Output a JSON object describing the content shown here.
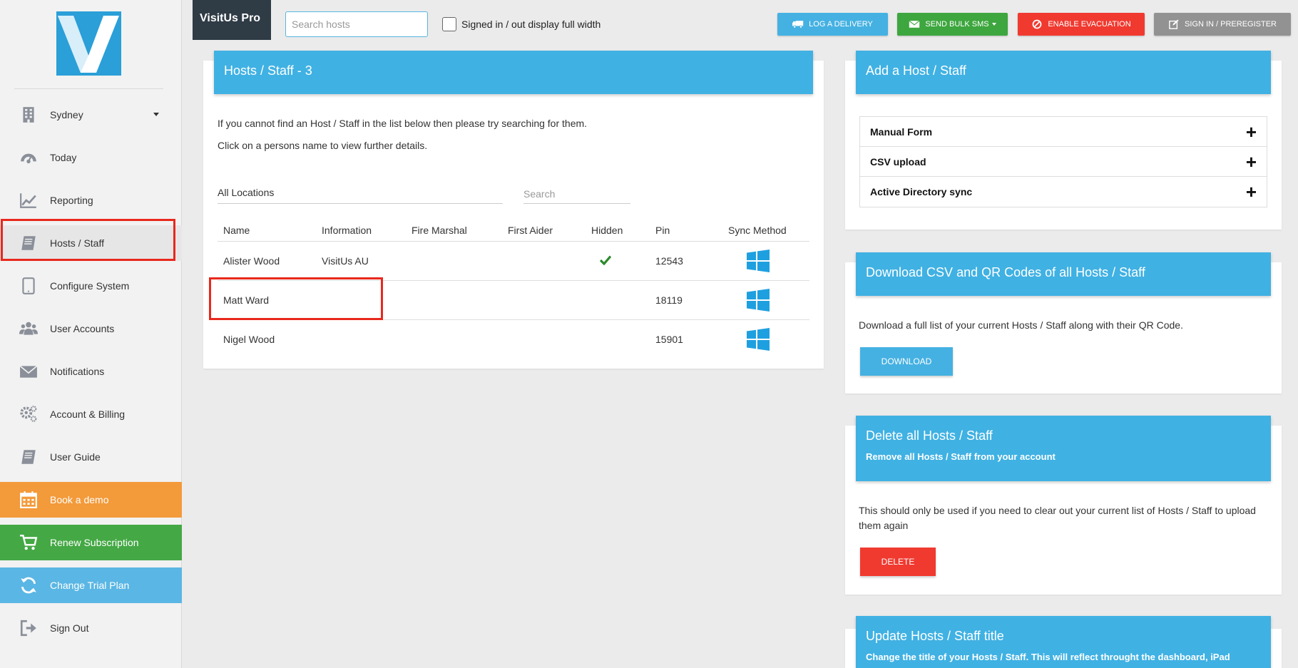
{
  "app": {
    "brand": "VisitUs Pro"
  },
  "sidebar": {
    "location": "Sydney",
    "items": [
      {
        "label": "Today",
        "icon": "dashboard-icon"
      },
      {
        "label": "Reporting",
        "icon": "chart-icon"
      },
      {
        "label": "Hosts / Staff",
        "icon": "book-icon"
      },
      {
        "label": "Configure System",
        "icon": "tablet-icon"
      },
      {
        "label": "User Accounts",
        "icon": "users-icon"
      },
      {
        "label": "Notifications",
        "icon": "envelope-icon"
      },
      {
        "label": "Account & Billing",
        "icon": "gears-icon"
      },
      {
        "label": "User Guide",
        "icon": "book-icon"
      },
      {
        "label": "Book a demo",
        "icon": "calendar-icon"
      },
      {
        "label": "Renew Subscription",
        "icon": "cart-icon"
      },
      {
        "label": "Change Trial Plan",
        "icon": "refresh-icon"
      },
      {
        "label": "Sign Out",
        "icon": "sign-out-icon"
      }
    ]
  },
  "topbar": {
    "search_placeholder": "Search hosts",
    "full_width_label": "Signed in / out display full width",
    "buttons": {
      "log_delivery": "LOG A DELIVERY",
      "bulk_sms": "SEND BULK SMS",
      "evacuation": "ENABLE EVACUATION",
      "sign_in": "SIGN IN / PREREGISTER"
    }
  },
  "hosts_panel": {
    "title": "Hosts / Staff - 3",
    "intro_1": "If you cannot find an Host / Staff in the list below then please try searching for them.",
    "intro_2": "Click on a persons name to view further details.",
    "location_filter": "All Locations",
    "search_placeholder": "Search",
    "columns": [
      "Name",
      "Information",
      "Fire Marshal",
      "First Aider",
      "Hidden",
      "Pin",
      "Sync Method"
    ],
    "rows": [
      {
        "name": "Alister Wood",
        "information": "VisitUs AU",
        "fire_marshal": "",
        "first_aider": "",
        "hidden": true,
        "pin": "12543",
        "sync": "windows-icon"
      },
      {
        "name": "Matt Ward",
        "information": "",
        "fire_marshal": "",
        "first_aider": "",
        "hidden": false,
        "pin": "18119",
        "sync": "windows-icon"
      },
      {
        "name": "Nigel Wood",
        "information": "",
        "fire_marshal": "",
        "first_aider": "",
        "hidden": false,
        "pin": "15901",
        "sync": "windows-icon"
      }
    ]
  },
  "add_panel": {
    "title": "Add a Host / Staff",
    "items": [
      "Manual Form",
      "CSV upload",
      "Active Directory sync"
    ]
  },
  "download_panel": {
    "title": "Download CSV and QR Codes of all Hosts / Staff",
    "text": "Download a full list of your current Hosts / Staff along with their QR Code.",
    "button": "DOWNLOAD"
  },
  "delete_panel": {
    "title": "Delete all Hosts / Staff",
    "subtitle": "Remove all Hosts / Staff from your account",
    "text_1": "This should only be used if you need to clear out your current list of Hosts / Staff to upload",
    "text_2": "them again",
    "button": "DELETE"
  },
  "update_panel": {
    "title": "Update Hosts / Staff title",
    "subtitle": "Change the title of your Hosts / Staff. This will reflect throught the dashboard, iPad"
  },
  "colors": {
    "accent": "#40b1e3",
    "orange": "#f39a3a",
    "green": "#44a845",
    "red": "#f03a30",
    "highlight": "#e8281c"
  }
}
